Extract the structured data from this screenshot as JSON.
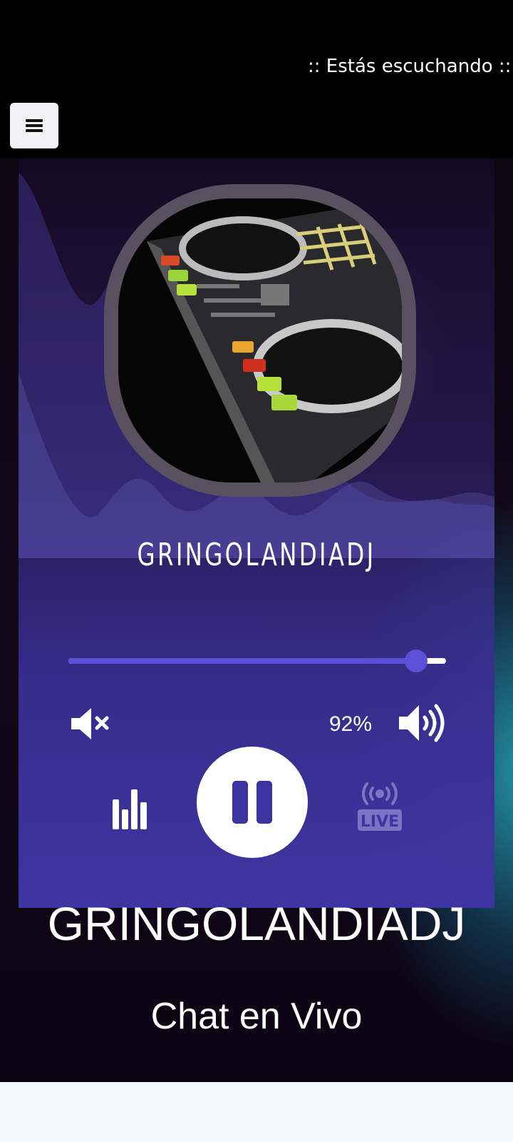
{
  "marquee": {
    "text": ":: Estás escuchando :: G"
  },
  "menu": {
    "icon": "hamburger-icon"
  },
  "player": {
    "station_name": "GRINGOLANDIADJ",
    "volume": {
      "level": 0.92,
      "label": "92%"
    },
    "mute_icon": "volume-mute-icon",
    "volume_icon": "volume-up-icon",
    "equalizer_icon": "equalizer-icon",
    "play_state_icon": "pause-icon",
    "live_icon": "live-broadcast-icon",
    "live_label": "LIVE"
  },
  "main": {
    "title": "GRINGOLANDIADJ",
    "chat_link": "Chat en Vivo"
  },
  "colors": {
    "accent": "#5b50d6",
    "panel": "#3f35a2",
    "bottom_bar": "#f3f6fd"
  }
}
